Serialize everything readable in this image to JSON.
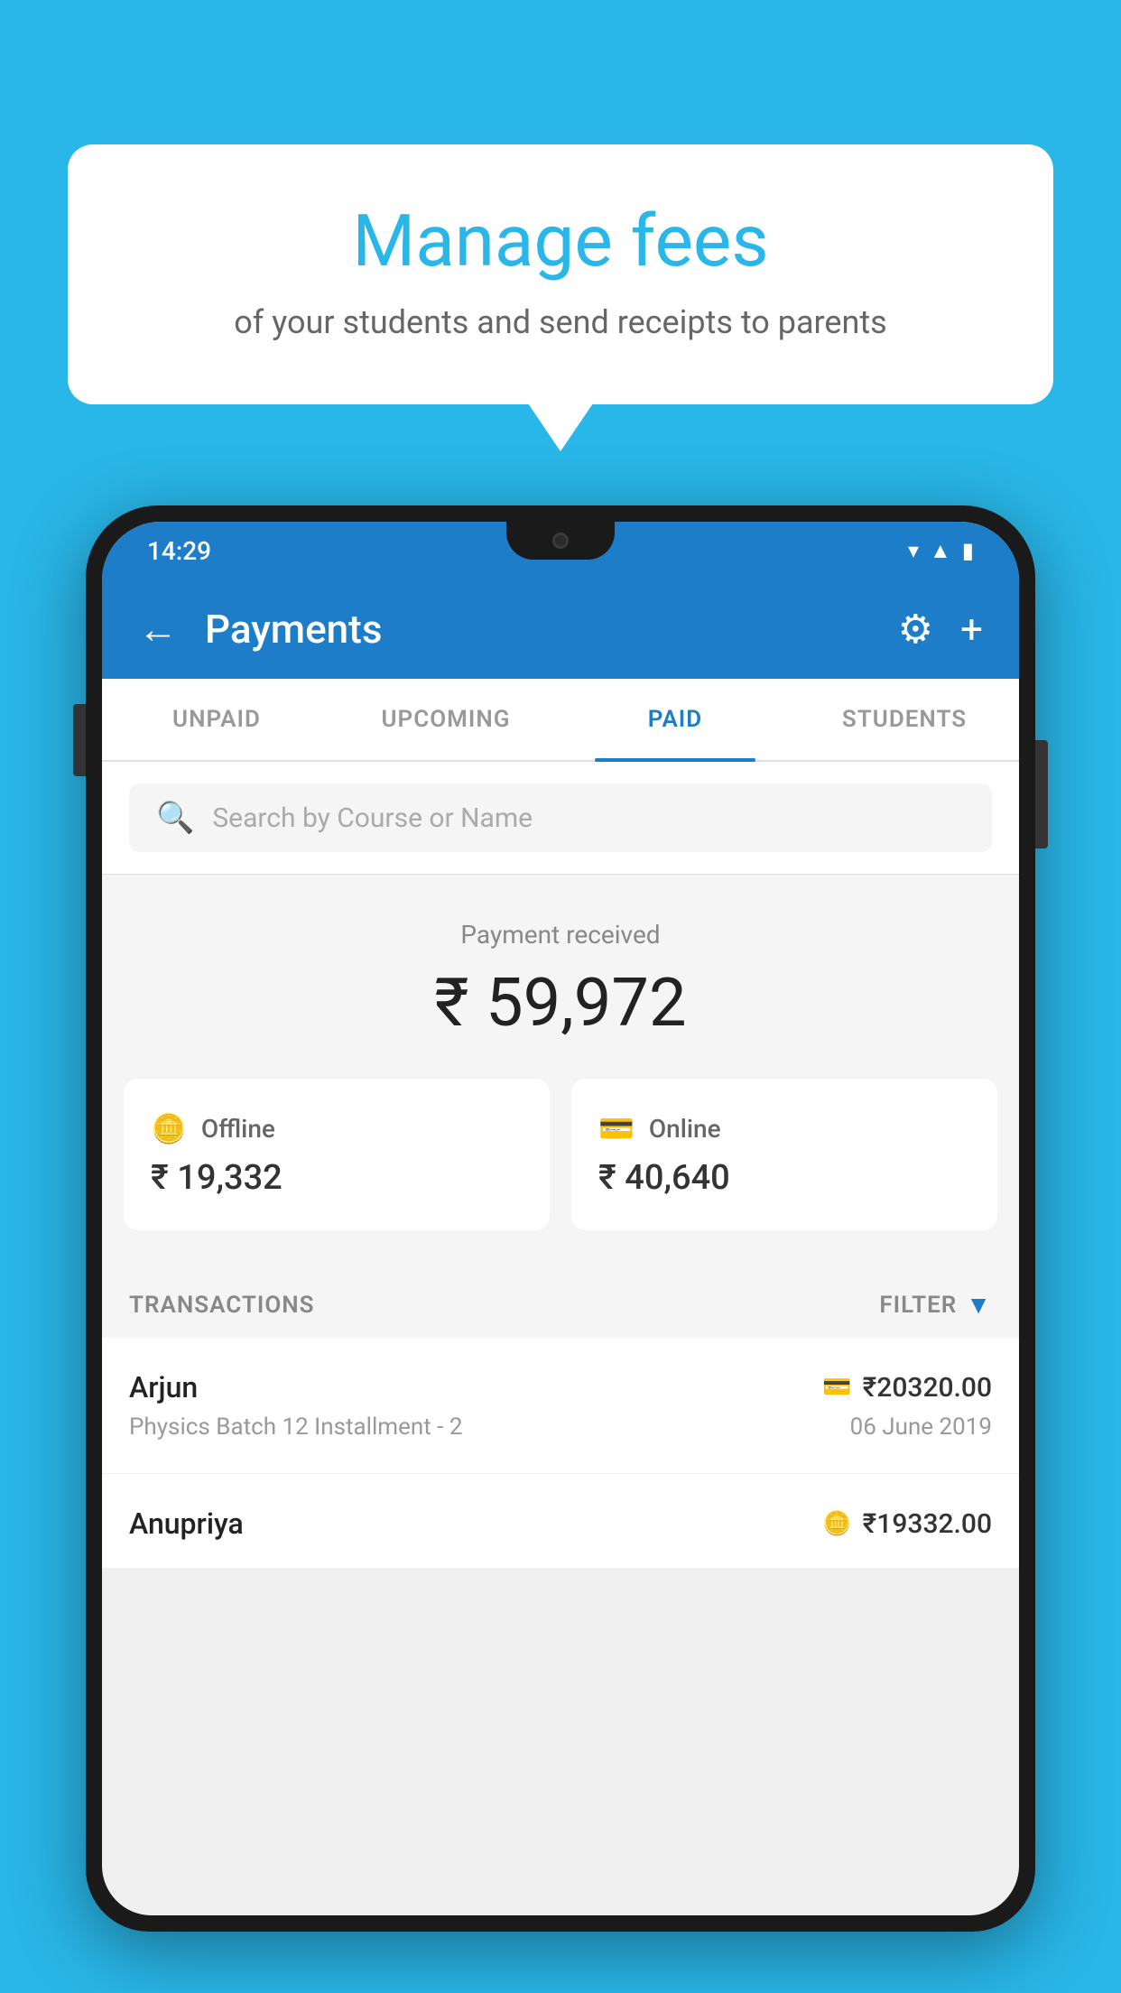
{
  "background_color": "#29b6e8",
  "speech_bubble": {
    "title": "Manage fees",
    "subtitle": "of your students and send receipts to parents"
  },
  "status_bar": {
    "time": "14:29",
    "icons": [
      "wifi",
      "signal",
      "battery"
    ]
  },
  "app_bar": {
    "title": "Payments",
    "back_label": "←",
    "gear_label": "⚙",
    "plus_label": "+"
  },
  "tabs": [
    {
      "label": "UNPAID",
      "active": false
    },
    {
      "label": "UPCOMING",
      "active": false
    },
    {
      "label": "PAID",
      "active": true
    },
    {
      "label": "STUDENTS",
      "active": false
    }
  ],
  "search": {
    "placeholder": "Search by Course or Name"
  },
  "payment_received": {
    "label": "Payment received",
    "amount": "₹ 59,972"
  },
  "payment_cards": [
    {
      "icon": "offline",
      "label": "Offline",
      "amount": "₹ 19,332"
    },
    {
      "icon": "online",
      "label": "Online",
      "amount": "₹ 40,640"
    }
  ],
  "transactions_section": {
    "label": "TRANSACTIONS",
    "filter_label": "FILTER"
  },
  "transactions": [
    {
      "name": "Arjun",
      "pay_icon": "card",
      "amount": "₹20320.00",
      "detail": "Physics Batch 12 Installment - 2",
      "date": "06 June 2019"
    },
    {
      "name": "Anupriya",
      "pay_icon": "cash",
      "amount": "₹19332.00",
      "detail": "",
      "date": ""
    }
  ]
}
